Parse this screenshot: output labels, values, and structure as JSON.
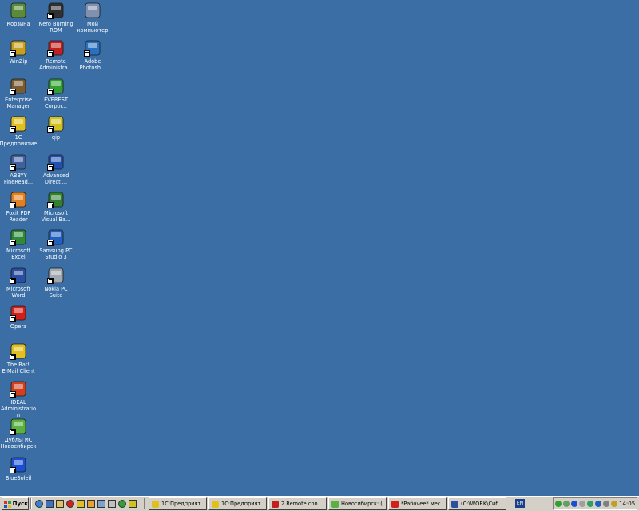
{
  "desktop": {
    "background": "#3a6ea5",
    "icons": [
      {
        "label": "Корзина",
        "icon": "recycle-bin-icon",
        "color": "#5a8a3a"
      },
      {
        "label": "WinZip",
        "icon": "winzip-icon",
        "color": "#c8a020"
      },
      {
        "label": "Enterprise\nManager",
        "icon": "enterprise-manager-icon",
        "color": "#7a5a30"
      },
      {
        "label": "1C\nПредприятие",
        "icon": "1c-icon",
        "color": "#e0c020"
      },
      {
        "label": "ABBYY\nFineRead...",
        "icon": "abbyy-icon",
        "color": "#4060a0"
      },
      {
        "label": "Foxit PDF\nReader",
        "icon": "foxit-icon",
        "color": "#e08020"
      },
      {
        "label": "Microsoft\nExcel",
        "icon": "excel-icon",
        "color": "#2e8a3a"
      },
      {
        "label": "Microsoft\nWord",
        "icon": "word-icon",
        "color": "#2a4ea0"
      },
      {
        "label": "Opera",
        "icon": "opera-icon",
        "color": "#d0201a"
      },
      {
        "label": "The Bat!\nE-Mail Client",
        "icon": "bat-icon",
        "color": "#e0c020"
      },
      {
        "label": "IDEAL\nAdministration",
        "icon": "ideal-icon",
        "color": "#d04020"
      },
      {
        "label": "ДубльГИС\nНовосибирск",
        "icon": "dublgis-icon",
        "color": "#5ab040"
      },
      {
        "label": "BlueSoleil",
        "icon": "bluetooth-icon",
        "color": "#1a4fd0"
      },
      {
        "label": "Nero Burning\nROM",
        "icon": "nero-icon",
        "color": "#303030"
      },
      {
        "label": "Remote\nAdministra...",
        "icon": "remote-admin-icon",
        "color": "#c02020"
      },
      {
        "label": "EVEREST\nCorpor...",
        "icon": "everest-icon",
        "color": "#30a030"
      },
      {
        "label": "qip",
        "icon": "qip-icon",
        "color": "#d0c020"
      },
      {
        "label": "Advanced\nDirect ...",
        "icon": "advanced-direct-icon",
        "color": "#2050b0"
      },
      {
        "label": "Microsoft\nVisual Ba...",
        "icon": "visual-basic-icon",
        "color": "#308030"
      },
      {
        "label": "Samsung PC\nStudio 3",
        "icon": "samsung-icon",
        "color": "#2060c0"
      },
      {
        "label": "Nokia PC Suite",
        "icon": "nokia-icon",
        "color": "#a0a8b0"
      },
      {
        "label": "Мой\nкомпьютер",
        "icon": "my-computer-icon",
        "color": "#8090b0"
      },
      {
        "label": "Adobe\nPhotosh...",
        "icon": "photoshop-icon",
        "color": "#2a70c0"
      }
    ]
  },
  "taskbar": {
    "start_label": "Пуск",
    "tasks": [
      {
        "label": "1С:Предприят...",
        "color": "#e0c020"
      },
      {
        "label": "1С:Предприят...",
        "color": "#e0c020"
      },
      {
        "label": "2 Remote con...",
        "color": "#c02020"
      },
      {
        "label": "Новосибирск: (...",
        "color": "#5ab040"
      },
      {
        "label": "*Рабочее* мес...",
        "color": "#d0201a"
      },
      {
        "label": "(C:\\WORK\\Сиб...",
        "color": "#2a4ea0"
      }
    ],
    "lang": "EN",
    "clock": "14:05"
  }
}
